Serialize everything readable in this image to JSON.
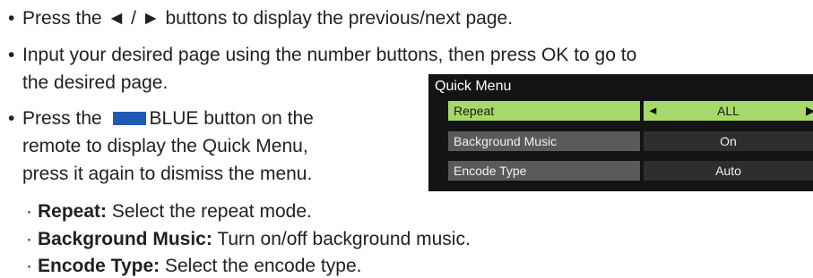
{
  "instructions": {
    "line1": {
      "prefix": "Press the ",
      "arrows": "◄ / ►",
      "suffix": " buttons to display the previous/next page."
    },
    "line2": "Input your desired page using the number buttons, then press OK to go to",
    "line3": "the desired page.",
    "line4": {
      "prefix": "Press the ",
      "suffix": "BLUE button on the"
    },
    "line5": "remote to display the Quick Menu,",
    "line6": "press it again to dismiss the menu.",
    "sub_items": [
      {
        "term": "Repeat:",
        "desc": " Select the repeat mode."
      },
      {
        "term": "Background Music:",
        "desc": " Turn on/off background music."
      },
      {
        "term": "Encode Type:",
        "desc": " Select the encode type."
      }
    ],
    "bullet": "•",
    "sub_bullet": "·"
  },
  "quick_menu": {
    "title": "Quick Menu",
    "rows": [
      {
        "label": "Repeat",
        "value": "ALL",
        "left_arrow": "◄",
        "right_arrow": "▶"
      },
      {
        "label": "Background Music",
        "value": "On"
      },
      {
        "label": "Encode Type",
        "value": "Auto"
      }
    ]
  },
  "colors": {
    "blue_button": "#1f5ab5",
    "selected_row": "#a6d96a",
    "menu_background": "#141414"
  }
}
